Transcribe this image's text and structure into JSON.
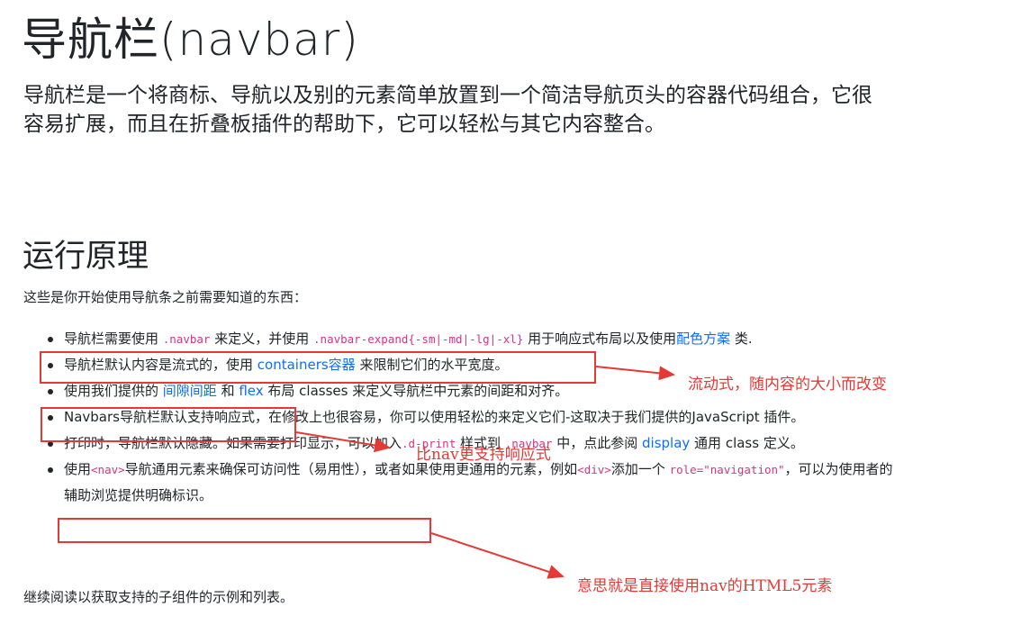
{
  "title": "导航栏(navbar)",
  "lead": "导航栏是一个将商标、导航以及别的元素简单放置到一个简洁导航页头的容器代码组合，它很容易扩展，而且在折叠板插件的帮助下，它可以轻松与其它内容整合。",
  "section": {
    "heading": "运行原理",
    "intro": "这些是你开始使用导航条之前需要知道的东西："
  },
  "items": {
    "i1": {
      "t1": "导航栏需要使用 ",
      "code1": ".navbar",
      "t2": " 来定义，并使用 ",
      "code2": ".navbar-expand{-sm|-md|-lg|-xl}",
      "t3": " 用于响应式布局以及使用",
      "link1": "配色方案",
      "t4": " 类."
    },
    "i2": {
      "t1": "导航栏默认内容是流式的，使用 ",
      "link1": "containers容器",
      "t2": " 来限制它们的水平宽度。"
    },
    "i3": {
      "t1": "使用我们提供的 ",
      "link1": "间隙间距",
      "t2": " 和 ",
      "link2": "flex",
      "t3": " 布局 classes 来定义导航栏中元素的间距和对齐。"
    },
    "i4": {
      "t1": "Navbars导航栏默认支持响应式",
      "t2": "，在修改上也很容易，你可以使用轻松的来定义它们-这取决于我们提供的JavaScript 插件。"
    },
    "i5": {
      "t1": "打印时，导航栏默认隐藏。如果需要打印显示，可以加入",
      "code1": ".d-print",
      "t2": " 样式到 ",
      "code2": ".navbar",
      "t3": " 中，点此参阅 ",
      "link1": "display",
      "t4": " 通用 class 定义。"
    },
    "i6": {
      "t1": "使用",
      "code1": "<nav>",
      "t2": "导航通用元素来确保可访问性（易用性）",
      "t3": "，或者如果使用更通用的元素，例如",
      "code2": "<div>",
      "t4": "添加一个 ",
      "code3": "role=\"navigation\"",
      "t5": "，可以为使用者的辅助浏览提供明确标识。"
    }
  },
  "footer": "继续阅读以获取支持的子组件的示例和列表。",
  "annotations": {
    "a1": "流动式，随内容的大小而改变",
    "a2": "比nav更支持响应式",
    "a3": "意思就是直接使用nav的HTML5元素"
  },
  "colors": {
    "annotation": "#e53935",
    "link": "#0d6efd",
    "code": "#d63384"
  }
}
